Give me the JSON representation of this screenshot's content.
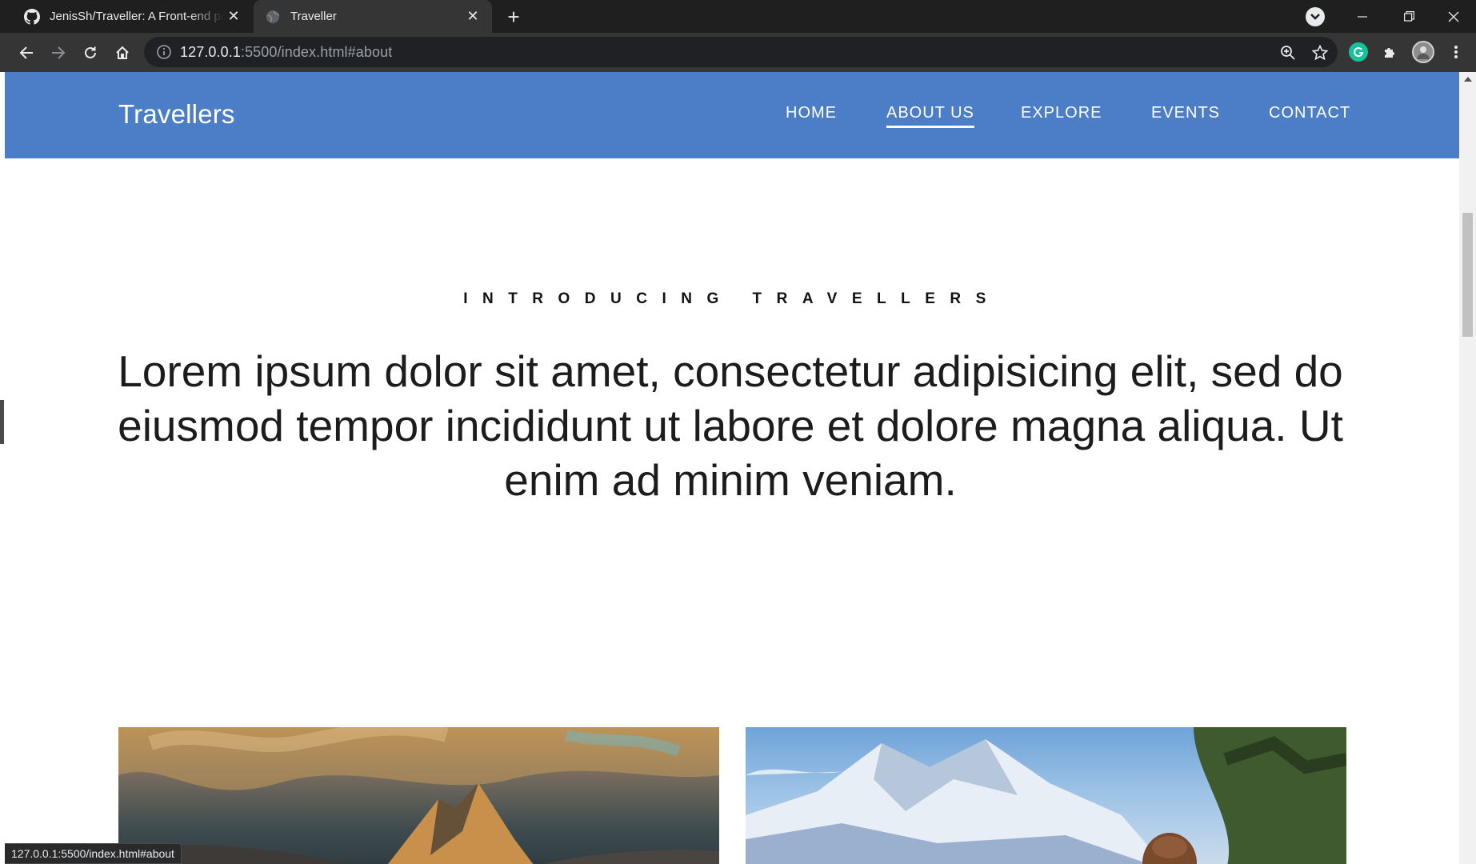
{
  "browser": {
    "tabs": [
      {
        "title": "JenisSh/Traveller: A Front-end pr",
        "favicon": "github-icon",
        "active": false
      },
      {
        "title": "Traveller",
        "favicon": "globe-icon",
        "active": true
      }
    ],
    "address": {
      "host": "127.0.0.1",
      "rest": ":5500/index.html#about"
    },
    "status_url": "127.0.0.1:5500/index.html#about"
  },
  "page": {
    "brand": "Travellers",
    "nav": [
      "HOME",
      "ABOUT US",
      "EXPLORE",
      "EVENTS",
      "CONTACT"
    ],
    "active_nav": "ABOUT US",
    "eyebrow": "INTRODUCING TRAVELLERS",
    "lead": "Lorem ipsum dolor sit amet, consectetur adipisicing elit, sed do eiusmod tempor incididunt ut labore et dolore magna aliqua. Ut enim ad minim veniam."
  },
  "colors": {
    "navbar": "#4c7ec7",
    "chrome_dark": "#1f1f1f",
    "chrome_toolbar": "#353535",
    "omnibox": "#202124"
  }
}
